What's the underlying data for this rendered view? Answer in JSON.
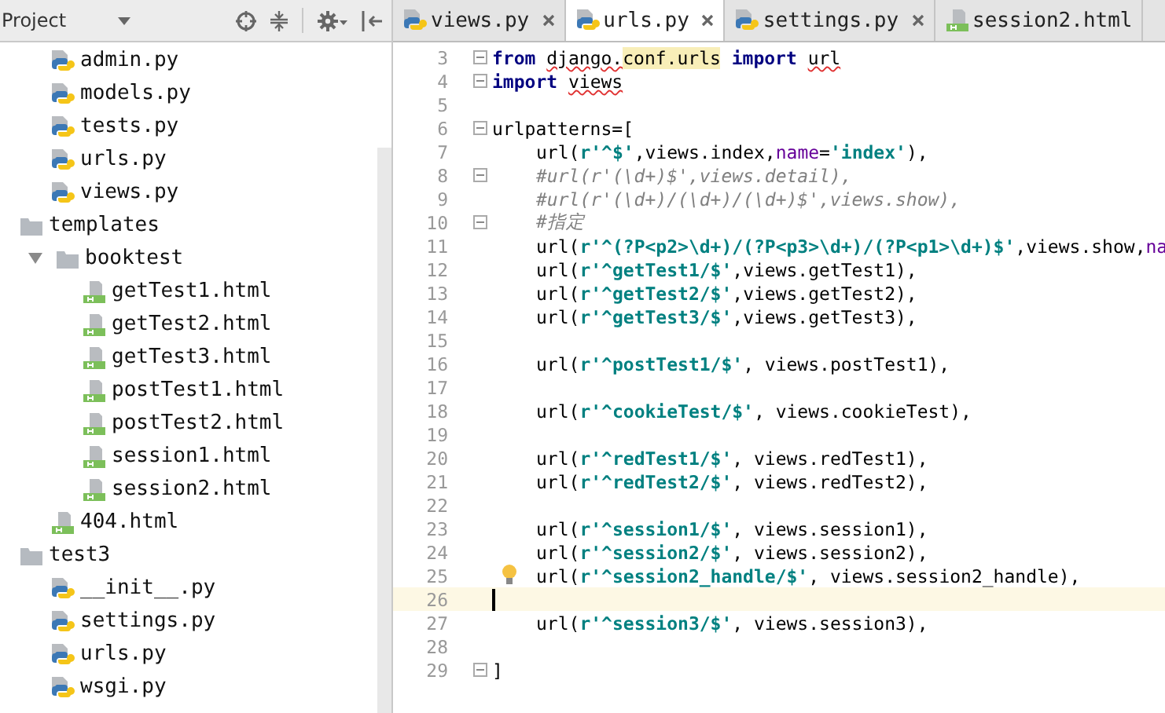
{
  "project_panel": {
    "title": "Project",
    "tree": {
      "cut_items": [
        {
          "name": "admin.py",
          "kind": "py"
        },
        {
          "name": "models.py",
          "kind": "py"
        },
        {
          "name": "tests.py",
          "kind": "py"
        },
        {
          "name": "urls.py",
          "kind": "py"
        },
        {
          "name": "views.py",
          "kind": "py"
        }
      ],
      "items": [
        {
          "name": "templates",
          "kind": "folder",
          "children": [
            {
              "name": "booktest",
              "kind": "folder",
              "expanded": true,
              "children": [
                {
                  "name": "getTest1.html",
                  "kind": "html"
                },
                {
                  "name": "getTest2.html",
                  "kind": "html"
                },
                {
                  "name": "getTest3.html",
                  "kind": "html"
                },
                {
                  "name": "postTest1.html",
                  "kind": "html"
                },
                {
                  "name": "postTest2.html",
                  "kind": "html"
                },
                {
                  "name": "session1.html",
                  "kind": "html"
                },
                {
                  "name": "session2.html",
                  "kind": "html"
                }
              ]
            },
            {
              "name": "404.html",
              "kind": "html"
            }
          ]
        },
        {
          "name": "test3",
          "kind": "folder",
          "children": [
            {
              "name": "__init__.py",
              "kind": "py"
            },
            {
              "name": "settings.py",
              "kind": "py"
            },
            {
              "name": "urls.py",
              "kind": "py"
            },
            {
              "name": "wsgi.py",
              "kind": "py"
            }
          ]
        }
      ]
    }
  },
  "tabs": [
    {
      "label": "views.py",
      "kind": "py",
      "selected": false,
      "closable": true
    },
    {
      "label": "urls.py",
      "kind": "py",
      "selected": true,
      "closable": true
    },
    {
      "label": "settings.py",
      "kind": "py",
      "selected": false,
      "closable": true
    },
    {
      "label": "session2.html",
      "kind": "html",
      "selected": false,
      "closable": false
    }
  ],
  "editor": {
    "lines": [
      {
        "number": "3",
        "fold": true,
        "current": false,
        "bulb": false,
        "indented": false,
        "tokens": [
          {
            "kind": "kw",
            "text": "from "
          },
          {
            "kind": "typo",
            "text": "django."
          },
          {
            "kind": "hl",
            "text": "conf."
          },
          {
            "kind": "hl",
            "text": "urls"
          },
          {
            "kind": "kw",
            "text": " import "
          },
          {
            "kind": "typo",
            "text": "url"
          }
        ]
      },
      {
        "number": "4",
        "fold": true,
        "current": false,
        "bulb": false,
        "indented": false,
        "tokens": [
          {
            "kind": "kw",
            "text": "import "
          },
          {
            "kind": "typo",
            "text": "views"
          }
        ]
      },
      {
        "number": "5",
        "fold": false,
        "current": false,
        "bulb": false,
        "indented": false
      },
      {
        "number": "6",
        "fold": true,
        "current": false,
        "bulb": false,
        "indented": false,
        "tokens": [
          {
            "kind": "plain",
            "text": "urlpatterns=["
          }
        ]
      },
      {
        "number": "7",
        "fold": false,
        "current": false,
        "bulb": false,
        "indented": true,
        "tokens": [
          {
            "kind": "plain",
            "text": "url("
          },
          {
            "kind": "str",
            "text": "r'^$'"
          },
          {
            "kind": "plain",
            "text": ",views.index,"
          },
          {
            "kind": "param",
            "text": "name"
          },
          {
            "kind": "plain",
            "text": "="
          },
          {
            "kind": "str",
            "text": "'index'"
          },
          {
            "kind": "plain",
            "text": "),"
          }
        ]
      },
      {
        "number": "8",
        "fold": true,
        "current": false,
        "bulb": false,
        "indented": true,
        "tokens": [
          {
            "kind": "comment",
            "text": "#url(r'(\\d+)$',views.detail),"
          }
        ]
      },
      {
        "number": "9",
        "fold": false,
        "current": false,
        "bulb": false,
        "indented": true,
        "tokens": [
          {
            "kind": "comment",
            "text": "#url(r'(\\d+)/(\\d+)/(\\d+)$',views.show),"
          }
        ]
      },
      {
        "number": "10",
        "fold": true,
        "current": false,
        "bulb": false,
        "indented": true,
        "tokens": [
          {
            "kind": "comment",
            "text": "#指定"
          }
        ]
      },
      {
        "number": "11",
        "fold": false,
        "current": false,
        "bulb": false,
        "indented": true,
        "tokens": [
          {
            "kind": "plain",
            "text": "url("
          },
          {
            "kind": "str",
            "text": "r'^(?P<p2>\\d+)/(?P<p3>\\d+)/(?P<p1>\\d+)$'"
          },
          {
            "kind": "plain",
            "text": ",views.show,"
          },
          {
            "kind": "param",
            "text": "na"
          }
        ]
      },
      {
        "number": "12",
        "fold": false,
        "current": false,
        "bulb": false,
        "indented": true,
        "tokens": [
          {
            "kind": "plain",
            "text": "url("
          },
          {
            "kind": "str",
            "text": "r'^getTest1/$'"
          },
          {
            "kind": "plain",
            "text": ",views.getTest1),"
          }
        ]
      },
      {
        "number": "13",
        "fold": false,
        "current": false,
        "bulb": false,
        "indented": true,
        "tokens": [
          {
            "kind": "plain",
            "text": "url("
          },
          {
            "kind": "str",
            "text": "r'^getTest2/$'"
          },
          {
            "kind": "plain",
            "text": ",views.getTest2),"
          }
        ]
      },
      {
        "number": "14",
        "fold": false,
        "current": false,
        "bulb": false,
        "indented": true,
        "tokens": [
          {
            "kind": "plain",
            "text": "url("
          },
          {
            "kind": "str",
            "text": "r'^getTest3/$'"
          },
          {
            "kind": "plain",
            "text": ",views.getTest3),"
          }
        ]
      },
      {
        "number": "15",
        "fold": false,
        "current": false,
        "bulb": false,
        "indented": false
      },
      {
        "number": "16",
        "fold": false,
        "current": false,
        "bulb": false,
        "indented": true,
        "tokens": [
          {
            "kind": "plain",
            "text": "url("
          },
          {
            "kind": "str",
            "text": "r'^postTest1/$'"
          },
          {
            "kind": "plain",
            "text": ", views.postTest1),"
          }
        ]
      },
      {
        "number": "17",
        "fold": false,
        "current": false,
        "bulb": false,
        "indented": false
      },
      {
        "number": "18",
        "fold": false,
        "current": false,
        "bulb": false,
        "indented": true,
        "tokens": [
          {
            "kind": "plain",
            "text": "url("
          },
          {
            "kind": "str",
            "text": "r'^cookieTest/$'"
          },
          {
            "kind": "plain",
            "text": ", views.cookieTest),"
          }
        ]
      },
      {
        "number": "19",
        "fold": false,
        "current": false,
        "bulb": false,
        "indented": false
      },
      {
        "number": "20",
        "fold": false,
        "current": false,
        "bulb": false,
        "indented": true,
        "tokens": [
          {
            "kind": "plain",
            "text": "url("
          },
          {
            "kind": "str",
            "text": "r'^redTest1/$'"
          },
          {
            "kind": "plain",
            "text": ", views.redTest1),"
          }
        ]
      },
      {
        "number": "21",
        "fold": false,
        "current": false,
        "bulb": false,
        "indented": true,
        "tokens": [
          {
            "kind": "plain",
            "text": "url("
          },
          {
            "kind": "str",
            "text": "r'^redTest2/$'"
          },
          {
            "kind": "plain",
            "text": ", views.redTest2),"
          }
        ]
      },
      {
        "number": "22",
        "fold": false,
        "current": false,
        "bulb": false,
        "indented": false
      },
      {
        "number": "23",
        "fold": false,
        "current": false,
        "bulb": false,
        "indented": true,
        "tokens": [
          {
            "kind": "plain",
            "text": "url("
          },
          {
            "kind": "str",
            "text": "r'^session1/$'"
          },
          {
            "kind": "plain",
            "text": ", views.session1),"
          }
        ]
      },
      {
        "number": "24",
        "fold": false,
        "current": false,
        "bulb": false,
        "indented": true,
        "tokens": [
          {
            "kind": "plain",
            "text": "url("
          },
          {
            "kind": "str",
            "text": "r'^session2/$'"
          },
          {
            "kind": "plain",
            "text": ", views.session2),"
          }
        ]
      },
      {
        "number": "25",
        "fold": false,
        "current": false,
        "bulb": true,
        "indented": true,
        "tokens": [
          {
            "kind": "plain",
            "text": "url("
          },
          {
            "kind": "str",
            "text": "r'^session2_handle/$'"
          },
          {
            "kind": "plain",
            "text": ", views.session2_handle),"
          }
        ]
      },
      {
        "number": "26",
        "fold": false,
        "current": true,
        "bulb": false,
        "indented": false
      },
      {
        "number": "27",
        "fold": false,
        "current": false,
        "bulb": false,
        "indented": true,
        "tokens": [
          {
            "kind": "plain",
            "text": "url("
          },
          {
            "kind": "str",
            "text": "r'^session3/$'"
          },
          {
            "kind": "plain",
            "text": ", views.session3),"
          }
        ]
      },
      {
        "number": "28",
        "fold": false,
        "current": false,
        "bulb": false,
        "indented": false
      },
      {
        "number": "29",
        "fold": true,
        "current": false,
        "bulb": false,
        "indented": false,
        "tokens": [
          {
            "kind": "plain",
            "text": "]"
          }
        ]
      }
    ]
  }
}
